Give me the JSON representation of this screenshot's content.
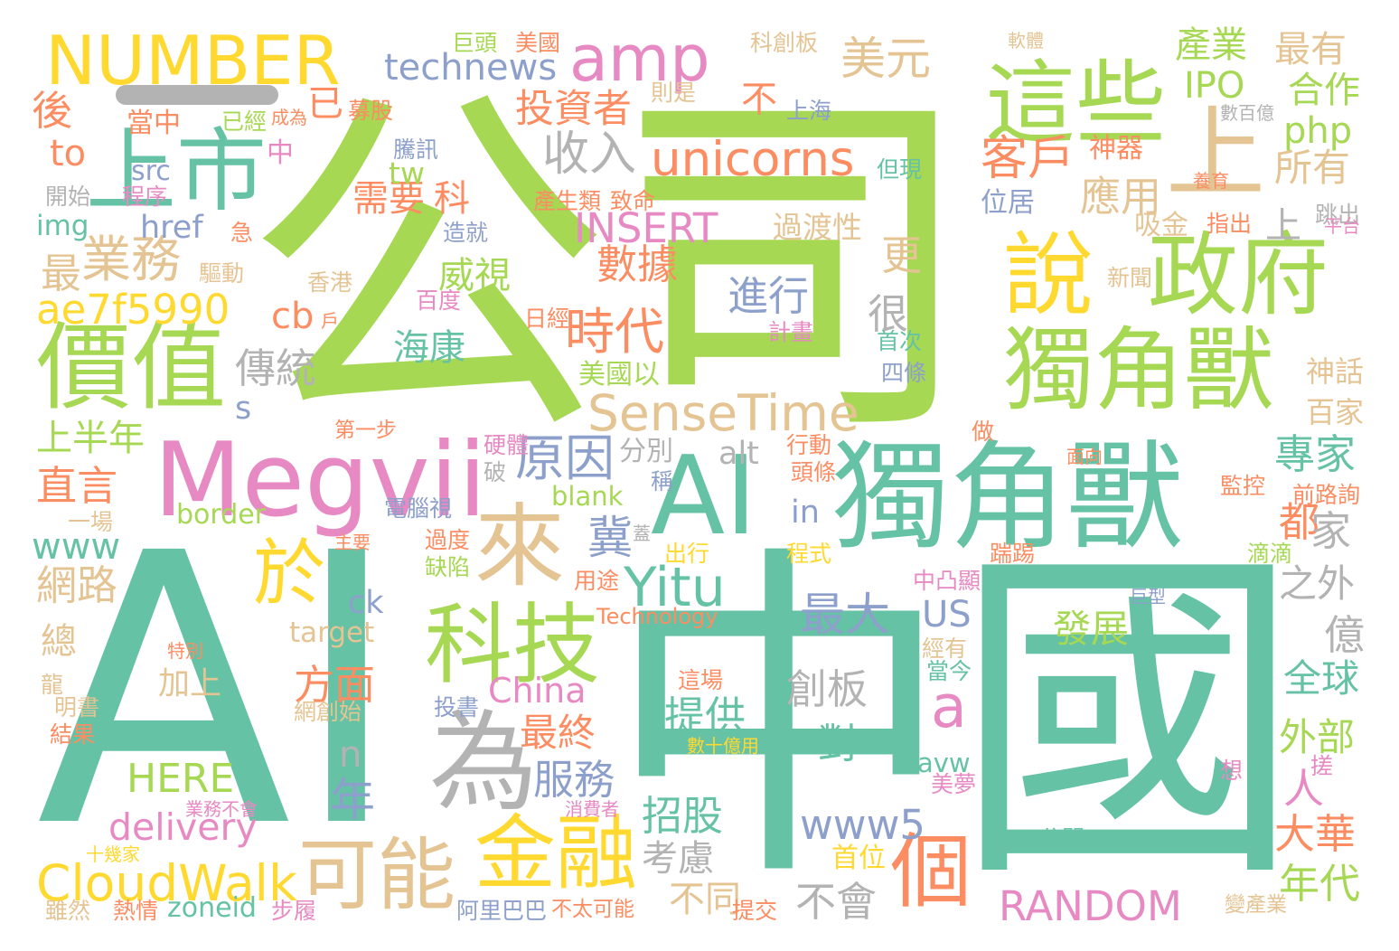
{
  "colors": {
    "green": "#66c2a5",
    "orange": "#fc8d62",
    "blue": "#8da0cb",
    "pink": "#e78ac3",
    "lime": "#a6d854",
    "yellow": "#ffd92f",
    "tan": "#e5c494",
    "gray": "#b3b3b3"
  },
  "words": [
    {
      "text": "公司",
      "color": "lime"
    },
    {
      "text": "中國",
      "color": "green"
    },
    {
      "text": "AI",
      "color": "green"
    },
    {
      "text": "AI",
      "color": "green"
    },
    {
      "text": "獨角獸",
      "color": "green"
    },
    {
      "text": "Megvii",
      "color": "pink"
    },
    {
      "text": "獨角獸",
      "color": "lime"
    },
    {
      "text": "說",
      "color": "yellow"
    },
    {
      "text": "政府",
      "color": "lime"
    },
    {
      "text": "這些",
      "color": "lime"
    },
    {
      "text": "上",
      "color": "tan"
    },
    {
      "text": "上市",
      "color": "green"
    },
    {
      "text": "價值",
      "color": "lime"
    },
    {
      "text": "NUMBER",
      "color": "yellow"
    },
    {
      "text": "amp",
      "color": "pink"
    },
    {
      "text": "為",
      "color": "gray"
    },
    {
      "text": "科技",
      "color": "lime"
    },
    {
      "text": "來",
      "color": "tan"
    },
    {
      "text": "於",
      "color": "yellow"
    },
    {
      "text": "金融",
      "color": "yellow"
    },
    {
      "text": "可能",
      "color": "tan"
    },
    {
      "text": "個",
      "color": "orange"
    },
    {
      "text": "unicorns",
      "color": "orange"
    },
    {
      "text": "SenseTime",
      "color": "tan"
    },
    {
      "text": "CloudWalk",
      "color": "yellow"
    },
    {
      "text": "Yitu",
      "color": "green"
    },
    {
      "text": "美元",
      "color": "tan"
    },
    {
      "text": "technews",
      "color": "blue"
    },
    {
      "text": "業務",
      "color": "tan"
    },
    {
      "text": "ae7f5990",
      "color": "yellow"
    },
    {
      "text": "收入",
      "color": "gray"
    },
    {
      "text": "投資者",
      "color": "orange"
    },
    {
      "text": "時代",
      "color": "orange"
    },
    {
      "text": "數據",
      "color": "orange"
    },
    {
      "text": "原因",
      "color": "blue"
    },
    {
      "text": "進行",
      "color": "blue"
    },
    {
      "text": "最大",
      "color": "blue"
    },
    {
      "text": "提供",
      "color": "green"
    },
    {
      "text": "創板",
      "color": "gray"
    },
    {
      "text": "RANDOM",
      "color": "pink"
    },
    {
      "text": "www5",
      "color": "blue"
    },
    {
      "text": "INSERT",
      "color": "pink"
    },
    {
      "text": "HERE",
      "color": "lime"
    },
    {
      "text": "delivery",
      "color": "pink"
    },
    {
      "text": "China",
      "color": "pink"
    },
    {
      "text": "服務",
      "color": "blue"
    },
    {
      "text": "最終",
      "color": "orange"
    },
    {
      "text": "方面",
      "color": "orange"
    },
    {
      "text": "招股",
      "color": "green"
    },
    {
      "text": "客戶",
      "color": "orange"
    },
    {
      "text": "應用",
      "color": "tan"
    },
    {
      "text": "所有",
      "color": "tan"
    },
    {
      "text": "專家",
      "color": "green"
    },
    {
      "text": "全球",
      "color": "green"
    },
    {
      "text": "外部",
      "color": "lime"
    },
    {
      "text": "大華",
      "color": "orange"
    },
    {
      "text": "年代",
      "color": "lime"
    },
    {
      "text": "發展",
      "color": "lime"
    },
    {
      "text": "網路",
      "color": "tan"
    },
    {
      "text": "php",
      "color": "lime"
    },
    {
      "text": "IPO",
      "color": "lime"
    },
    {
      "text": "產業",
      "color": "lime"
    },
    {
      "text": "最有",
      "color": "tan"
    },
    {
      "text": "合作",
      "color": "lime"
    },
    {
      "text": "威視",
      "color": "lime"
    },
    {
      "text": "海康",
      "color": "green"
    },
    {
      "text": "需要",
      "color": "orange"
    },
    {
      "text": "科",
      "color": "orange"
    },
    {
      "text": "傳統",
      "color": "gray"
    },
    {
      "text": "上半年",
      "color": "lime"
    },
    {
      "text": "直言",
      "color": "orange"
    },
    {
      "text": "www",
      "color": "green"
    },
    {
      "text": "cb",
      "color": "orange"
    },
    {
      "text": "to",
      "color": "orange"
    },
    {
      "text": "已",
      "color": "orange"
    },
    {
      "text": "不",
      "color": "orange"
    },
    {
      "text": "後",
      "color": "orange"
    },
    {
      "text": "最",
      "color": "tan"
    },
    {
      "text": "很",
      "color": "gray"
    },
    {
      "text": "更",
      "color": "tan"
    },
    {
      "text": "冀",
      "color": "blue"
    },
    {
      "text": "都",
      "color": "orange"
    },
    {
      "text": "家",
      "color": "gray"
    },
    {
      "text": "之外",
      "color": "gray"
    },
    {
      "text": "億",
      "color": "gray"
    },
    {
      "text": "人",
      "color": "pink"
    },
    {
      "text": "對",
      "color": "green"
    },
    {
      "text": "不會",
      "color": "gray"
    },
    {
      "text": "不同",
      "color": "tan"
    },
    {
      "text": "考慮",
      "color": "gray"
    },
    {
      "text": "年",
      "color": "blue"
    },
    {
      "text": "a",
      "color": "pink"
    },
    {
      "text": "n",
      "color": "gray"
    },
    {
      "text": "s",
      "color": "blue"
    },
    {
      "text": "tw",
      "color": "lime"
    },
    {
      "text": "in",
      "color": "blue"
    },
    {
      "text": "US",
      "color": "blue"
    },
    {
      "text": "ck",
      "color": "blue"
    },
    {
      "text": "總",
      "color": "tan"
    },
    {
      "text": "加上",
      "color": "tan"
    },
    {
      "text": "target",
      "color": "tan"
    },
    {
      "text": "zoneid",
      "color": "green"
    },
    {
      "text": "blank",
      "color": "lime"
    },
    {
      "text": "border",
      "color": "lime"
    },
    {
      "text": "img",
      "color": "green"
    },
    {
      "text": "href",
      "color": "blue"
    },
    {
      "text": "src",
      "color": "blue"
    },
    {
      "text": "alt",
      "color": "gray"
    },
    {
      "text": "avw",
      "color": "green"
    },
    {
      "text": "上",
      "color": "gray"
    },
    {
      "text": "分別",
      "color": "gray"
    },
    {
      "text": "過渡性",
      "color": "tan"
    },
    {
      "text": "神器",
      "color": "orange"
    },
    {
      "text": "吸金",
      "color": "tan"
    },
    {
      "text": "位居",
      "color": "blue"
    },
    {
      "text": "神話",
      "color": "tan"
    },
    {
      "text": "百家",
      "color": "tan"
    },
    {
      "text": "巨頭",
      "color": "lime"
    },
    {
      "text": "美國",
      "color": "orange"
    },
    {
      "text": "科創板",
      "color": "tan"
    },
    {
      "text": "上海",
      "color": "blue"
    },
    {
      "text": "則是",
      "color": "tan"
    },
    {
      "text": "當中",
      "color": "orange"
    },
    {
      "text": "已經",
      "color": "lime"
    },
    {
      "text": "募股",
      "color": "orange"
    },
    {
      "text": "騰訊",
      "color": "blue"
    },
    {
      "text": "但現",
      "color": "green"
    },
    {
      "text": "程序",
      "color": "pink"
    },
    {
      "text": "開始",
      "color": "gray"
    },
    {
      "text": "產生類",
      "color": "orange"
    },
    {
      "text": "致命",
      "color": "orange"
    },
    {
      "text": "造就",
      "color": "blue"
    },
    {
      "text": "指出",
      "color": "orange"
    },
    {
      "text": "跳出",
      "color": "gray"
    },
    {
      "text": "驅動",
      "color": "tan"
    },
    {
      "text": "香港",
      "color": "tan"
    },
    {
      "text": "百度",
      "color": "pink"
    },
    {
      "text": "日經",
      "color": "orange"
    },
    {
      "text": "計畫",
      "color": "pink"
    },
    {
      "text": "首次",
      "color": "green"
    },
    {
      "text": "四條",
      "color": "blue"
    },
    {
      "text": "新聞",
      "color": "tan"
    },
    {
      "text": "美國以",
      "color": "lime"
    },
    {
      "text": "第一步",
      "color": "orange"
    },
    {
      "text": "硬體",
      "color": "pink"
    },
    {
      "text": "行動",
      "color": "orange"
    },
    {
      "text": "頭條",
      "color": "orange"
    },
    {
      "text": "做",
      "color": "orange"
    },
    {
      "text": "破",
      "color": "gray"
    },
    {
      "text": "稱",
      "color": "blue"
    },
    {
      "text": "電腦視",
      "color": "blue"
    },
    {
      "text": "過度",
      "color": "orange"
    },
    {
      "text": "缺陷",
      "color": "lime"
    },
    {
      "text": "出行",
      "color": "yellow"
    },
    {
      "text": "程式",
      "color": "yellow"
    },
    {
      "text": "踹踢",
      "color": "orange"
    },
    {
      "text": "滴滴",
      "color": "lime"
    },
    {
      "text": "監控",
      "color": "orange"
    },
    {
      "text": "前路詢",
      "color": "orange"
    },
    {
      "text": "中凸顯",
      "color": "pink"
    },
    {
      "text": "用途",
      "color": "orange"
    },
    {
      "text": "Technology",
      "color": "orange"
    },
    {
      "text": "一場",
      "color": "tan"
    },
    {
      "text": "主要",
      "color": "orange"
    },
    {
      "text": "特別",
      "color": "orange"
    },
    {
      "text": "龍",
      "color": "tan"
    },
    {
      "text": "明書",
      "color": "tan"
    },
    {
      "text": "結果",
      "color": "orange"
    },
    {
      "text": "投書",
      "color": "blue"
    },
    {
      "text": "網創始",
      "color": "tan"
    },
    {
      "text": "這場",
      "color": "orange"
    },
    {
      "text": "數十億用",
      "color": "yellow"
    },
    {
      "text": "經有",
      "color": "tan"
    },
    {
      "text": "當今",
      "color": "green"
    },
    {
      "text": "美夢",
      "color": "pink"
    },
    {
      "text": "想",
      "color": "pink"
    },
    {
      "text": "搓",
      "color": "pink"
    },
    {
      "text": "業務不會",
      "color": "pink"
    },
    {
      "text": "消費者",
      "color": "pink"
    },
    {
      "text": "十幾家",
      "color": "yellow"
    },
    {
      "text": "雖然",
      "color": "tan"
    },
    {
      "text": "熱情",
      "color": "orange"
    },
    {
      "text": "步履",
      "color": "pink"
    },
    {
      "text": "阿里巴巴",
      "color": "blue"
    },
    {
      "text": "不太可能",
      "color": "orange"
    },
    {
      "text": "提交",
      "color": "orange"
    },
    {
      "text": "變產業",
      "color": "tan"
    },
    {
      "text": "公開",
      "color": "green"
    },
    {
      "text": "首位",
      "color": "yellow"
    },
    {
      "text": "中",
      "color": "pink"
    },
    {
      "text": "成為",
      "color": "orange"
    },
    {
      "text": "軟體",
      "color": "tan"
    },
    {
      "text": "數百億",
      "color": "gray"
    },
    {
      "text": "急",
      "color": "orange"
    },
    {
      "text": "平台",
      "color": "pink"
    },
    {
      "text": "養育",
      "color": "orange"
    },
    {
      "text": "面向",
      "color": "orange"
    },
    {
      "text": "戶",
      "color": "orange"
    },
    {
      "text": "蓋",
      "color": "gray"
    },
    {
      "text": "巨型",
      "color": "blue"
    }
  ]
}
